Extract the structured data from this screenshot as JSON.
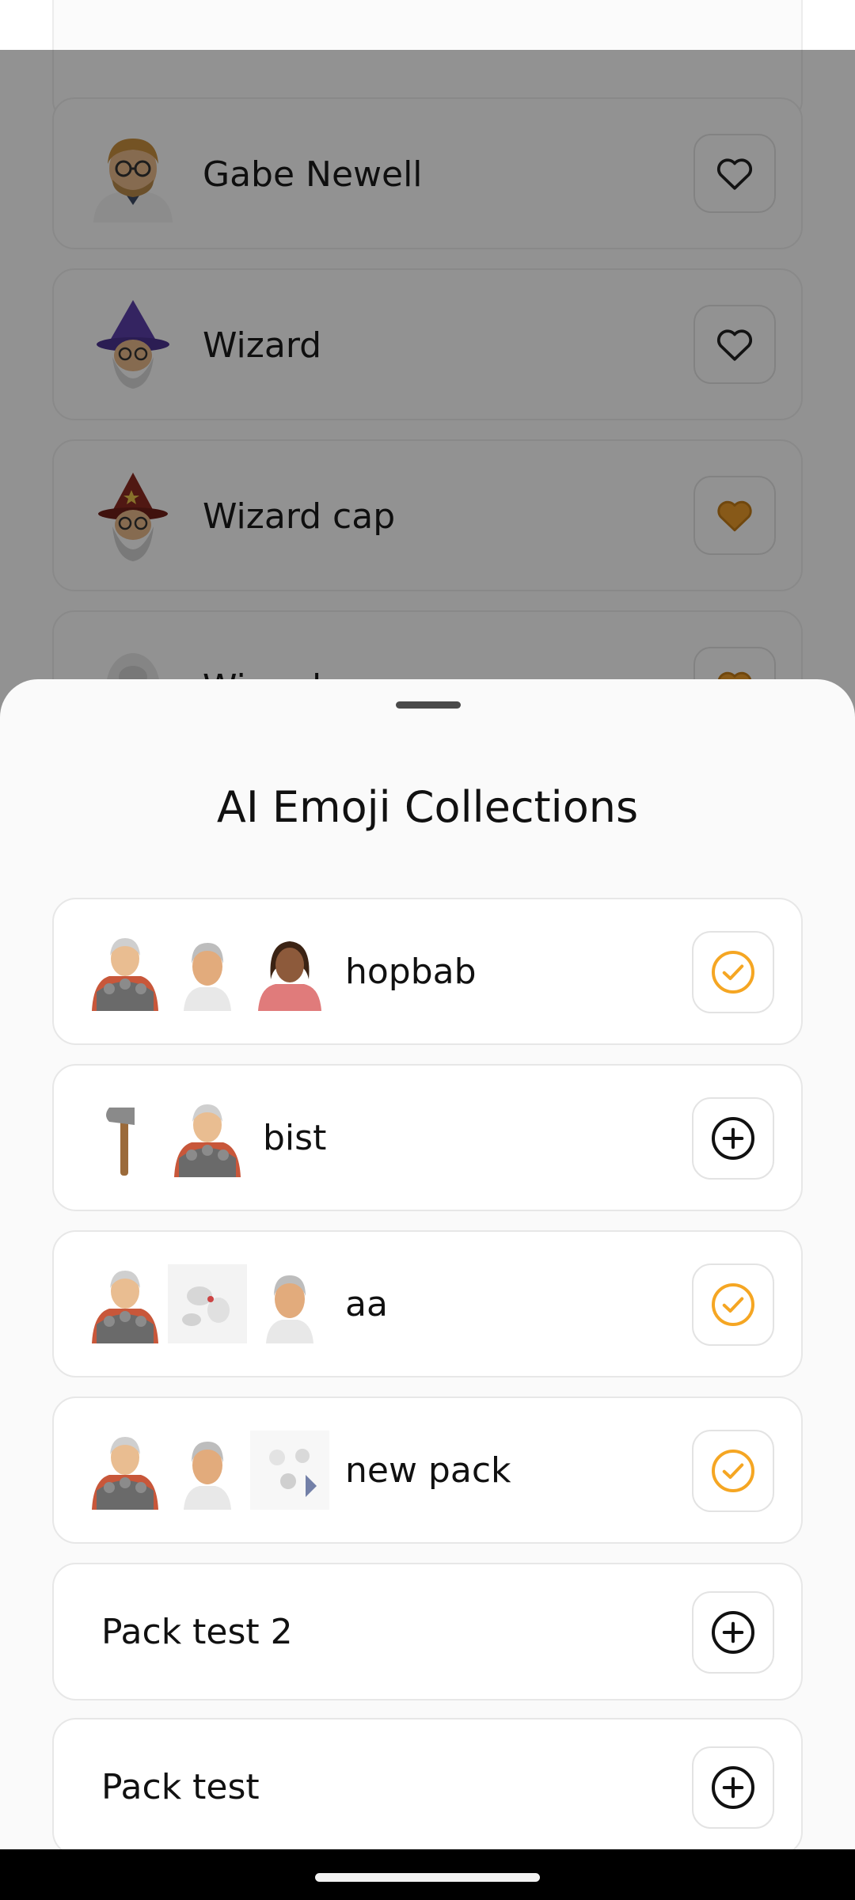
{
  "background_list": {
    "items": [
      {
        "name": "Gabe Newell",
        "avatar_icon": "man-glasses-avatar",
        "favorited": false
      },
      {
        "name": "Wizard",
        "avatar_icon": "wizard-avatar",
        "favorited": false
      },
      {
        "name": "Wizard cap",
        "avatar_icon": "wizard-cap-avatar",
        "favorited": true
      },
      {
        "name": "Wizard",
        "avatar_icon": "wizard-avatar",
        "favorited": true
      }
    ]
  },
  "sheet": {
    "title": "AI Emoji Collections",
    "collections": [
      {
        "name": "hopbab",
        "added": true,
        "thumbnails": [
          "armored-man-avatar",
          "gray-hair-man-avatar",
          "woman-avatar"
        ]
      },
      {
        "name": "bist",
        "added": false,
        "thumbnails": [
          "axe-icon",
          "armored-man-avatar"
        ]
      },
      {
        "name": "aa",
        "added": true,
        "thumbnails": [
          "armored-man-avatar",
          "sketch-thumbnail",
          "gray-hair-man-avatar"
        ]
      },
      {
        "name": "new pack",
        "added": true,
        "thumbnails": [
          "armored-man-avatar",
          "gray-hair-man-avatar",
          "faded-group-thumbnail"
        ]
      },
      {
        "name": "Pack test 2",
        "added": false,
        "thumbnails": []
      },
      {
        "name": "Pack test",
        "added": false,
        "thumbnails": []
      }
    ]
  },
  "colors": {
    "accent_orange": "#f5a623",
    "heart_orange": "#e89a2a",
    "text_primary": "#111111",
    "border": "#e7e7e7"
  }
}
